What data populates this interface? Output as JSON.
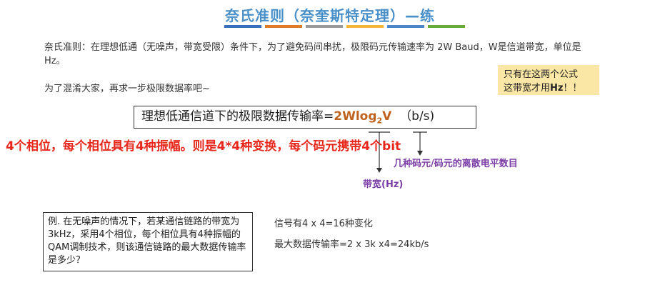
{
  "title": "奈氏准则（奈奎斯特定理）—练",
  "color_bar": [
    "#3a6fbd",
    "#e07b2a",
    "#9a9a9a",
    "#f2b632",
    "#4a86c8",
    "#6aaa3a"
  ],
  "definition": "奈氏准则：在理想低通（无噪声，带宽受限）条件下，为了避免码间串扰，极限码元传输速率为 2W Baud，W是信道带宽，单位是Hz。",
  "chaos_line": "为了混淆大家，再求一步极限数据率吧~",
  "note": {
    "line1": "只有在这两个公式",
    "line2_prefix": "这带宽才用",
    "line2_bold": "Hz",
    "line2_suffix": "！！"
  },
  "formula": {
    "label": "理想低通信道下的极限数据传输率=",
    "value_prefix": "2Wlog",
    "value_sub": "2",
    "value_suffix": "V",
    "unit": "（b/s)"
  },
  "red_annotation": "4个相位，每个相位具有4种振幅。则是4*4种变换，每个码元携带4个bit",
  "levels_label": "几种码元/码元的离散电平数目",
  "bandwidth_label": "带宽(Hz)",
  "example": "例. 在无噪声的情况下，若某通信链路的带宽为3kHz，采用4个相位，每个相位具有4种振幅的QAM调制技术，则该通信链路的最大数据传输率是多少？",
  "answer": {
    "line1": "信号有4 x 4=16种变化",
    "line2": "最大数据传输率=2 x 3k x4=24kb/s"
  }
}
